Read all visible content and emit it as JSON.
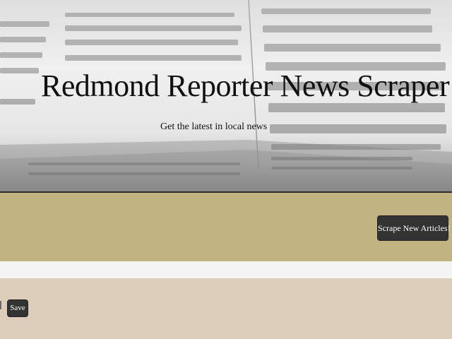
{
  "header": {
    "title": "Redmond Reporter News Scraper",
    "subtitle": "Get the latest in local news"
  },
  "actions": {
    "scrape_label": "Scrape New Articles!"
  },
  "articles": {
    "save_label": "Save"
  },
  "colors": {
    "action_band": "#c2b382",
    "content_band": "#dccebb",
    "button_bg": "#333333",
    "button_text": "#ffffff",
    "page_bg": "#f4f4f4"
  },
  "icons": {
    "hero_background": "newspaper-image"
  }
}
